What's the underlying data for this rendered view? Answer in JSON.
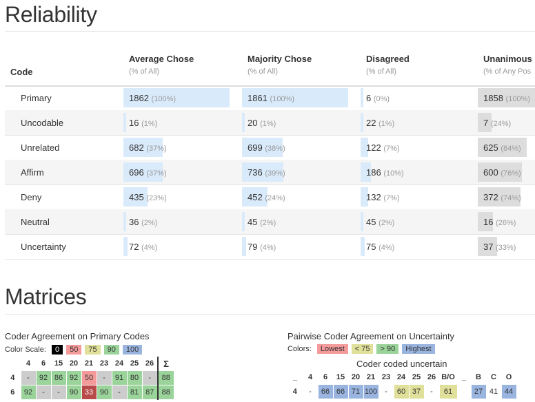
{
  "reliability": {
    "title": "Reliability",
    "code_header": "Code",
    "columns": [
      {
        "title": "Average Chose",
        "sub": "(% of All)"
      },
      {
        "title": "Majority Chose",
        "sub": "(% of All)"
      },
      {
        "title": "Disagreed",
        "sub": "(% of All)"
      },
      {
        "title": "Unanimous",
        "sub": "(% of Any Pos"
      }
    ],
    "rows": [
      {
        "name": "Primary",
        "cells": [
          {
            "value": "1862",
            "pct": "(100%)",
            "fill": 1.0
          },
          {
            "value": "1861",
            "pct": "(100%)",
            "fill": 1.0
          },
          {
            "value": "6",
            "pct": "(0%)",
            "fill": 0.0
          },
          {
            "value": "1858",
            "pct": "(100%)",
            "fill": 1.0
          }
        ]
      },
      {
        "name": "Uncodable",
        "cells": [
          {
            "value": "16",
            "pct": "(1%)",
            "fill": 0.01
          },
          {
            "value": "20",
            "pct": "(1%)",
            "fill": 0.01
          },
          {
            "value": "22",
            "pct": "(1%)",
            "fill": 0.01
          },
          {
            "value": "7",
            "pct": "(24%)",
            "fill": 0.24
          }
        ]
      },
      {
        "name": "Unrelated",
        "cells": [
          {
            "value": "682",
            "pct": "(37%)",
            "fill": 0.37
          },
          {
            "value": "699",
            "pct": "(38%)",
            "fill": 0.38
          },
          {
            "value": "122",
            "pct": "(7%)",
            "fill": 0.07
          },
          {
            "value": "625",
            "pct": "(84%)",
            "fill": 0.84
          }
        ]
      },
      {
        "name": "Affirm",
        "cells": [
          {
            "value": "696",
            "pct": "(37%)",
            "fill": 0.37
          },
          {
            "value": "736",
            "pct": "(39%)",
            "fill": 0.39
          },
          {
            "value": "186",
            "pct": "(10%)",
            "fill": 0.1
          },
          {
            "value": "600",
            "pct": "(76%)",
            "fill": 0.76
          }
        ]
      },
      {
        "name": "Deny",
        "cells": [
          {
            "value": "435",
            "pct": "(23%)",
            "fill": 0.23
          },
          {
            "value": "452",
            "pct": "(24%)",
            "fill": 0.24
          },
          {
            "value": "132",
            "pct": "(7%)",
            "fill": 0.07
          },
          {
            "value": "372",
            "pct": "(74%)",
            "fill": 0.74
          }
        ]
      },
      {
        "name": "Neutral",
        "cells": [
          {
            "value": "36",
            "pct": "(2%)",
            "fill": 0.02
          },
          {
            "value": "45",
            "pct": "(2%)",
            "fill": 0.02
          },
          {
            "value": "45",
            "pct": "(2%)",
            "fill": 0.02
          },
          {
            "value": "16",
            "pct": "(26%)",
            "fill": 0.26
          }
        ]
      },
      {
        "name": "Uncertainty",
        "cells": [
          {
            "value": "72",
            "pct": "(4%)",
            "fill": 0.04
          },
          {
            "value": "79",
            "pct": "(4%)",
            "fill": 0.04
          },
          {
            "value": "75",
            "pct": "(4%)",
            "fill": 0.04
          },
          {
            "value": "37",
            "pct": "(33%)",
            "fill": 0.33
          }
        ]
      }
    ],
    "colors": {
      "blue_bar": "#d9eafb",
      "grey_bar": "#dddddd"
    }
  },
  "matrices": {
    "title": "Matrices",
    "primary": {
      "title": "Coder Agreement on Primary Codes",
      "scale_label": "Color Scale:",
      "scale": [
        {
          "label": "0",
          "color": "#000000",
          "text": "#ffffff"
        },
        {
          "label": "50",
          "color": "#f49a9a",
          "text": "#333333"
        },
        {
          "label": "75",
          "color": "#e0e09a",
          "text": "#333333"
        },
        {
          "label": "90",
          "color": "#9ad49a",
          "text": "#333333"
        },
        {
          "label": "100",
          "color": "#9ab4e0",
          "text": "#333333"
        }
      ],
      "headers": [
        "4",
        "6",
        "15",
        "20",
        "21",
        "23",
        "24",
        "25",
        "26",
        "Σ"
      ],
      "rows": [
        {
          "label": "4",
          "cells": [
            "-",
            "92",
            "86",
            "92",
            "50",
            "-",
            "91",
            "80",
            "-",
            "88"
          ]
        },
        {
          "label": "6",
          "cells": [
            "92",
            "-",
            "-",
            "90",
            "33",
            "90",
            "-",
            "81",
            "87",
            "88"
          ]
        }
      ]
    },
    "uncertainty": {
      "title": "Pairwise Coder Agreement on Uncertainty",
      "colors_label": "Colors:",
      "legend": [
        {
          "label": "Lowest",
          "color": "#f49a9a"
        },
        {
          "label": "< 75",
          "color": "#e0e09a"
        },
        {
          "label": "> 90",
          "color": "#9ad49a"
        },
        {
          "label": "Highest",
          "color": "#9ab4e0"
        }
      ],
      "caption": "Coder coded uncertain",
      "corner": "_",
      "headers": [
        "4",
        "6",
        "15",
        "20",
        "21",
        "23",
        "24",
        "25",
        "26",
        "B/O"
      ],
      "sep": "_",
      "headers2": [
        "B",
        "C",
        "O"
      ],
      "rows": [
        {
          "label": "4",
          "cells": [
            "-",
            "66",
            "66",
            "71",
            "100",
            "-",
            "60",
            "37",
            "-",
            "61"
          ],
          "cells2": [
            "27",
            "41",
            "44"
          ]
        }
      ]
    }
  }
}
